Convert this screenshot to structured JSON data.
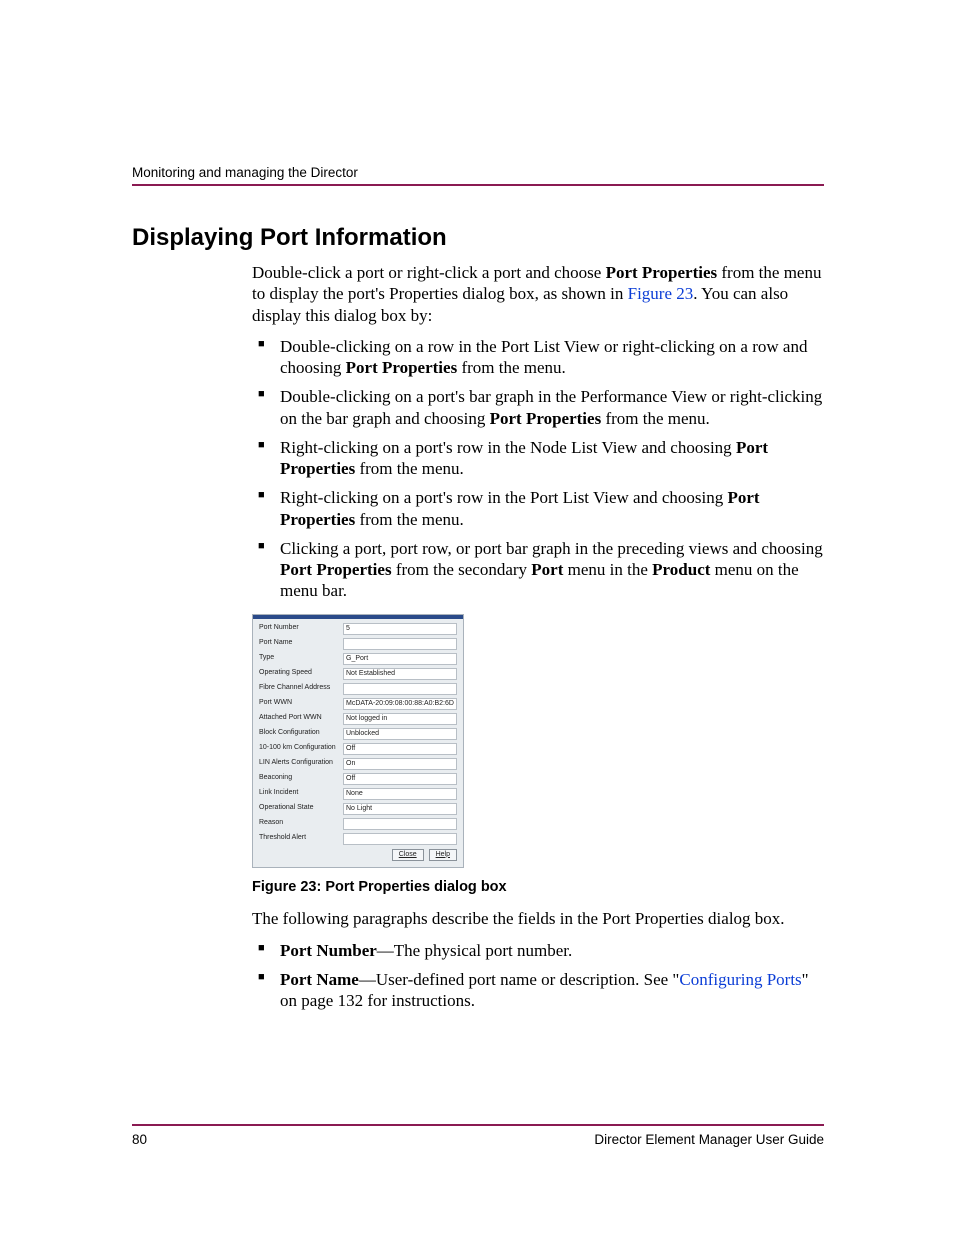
{
  "header": {
    "running": "Monitoring and managing the Director"
  },
  "section": {
    "title": "Displaying Port Information"
  },
  "intro": {
    "p1_a": "Double-click a port or right-click a port and choose ",
    "p1_b": "Port Properties",
    "p1_c": " from the menu to display the port's Properties dialog box, as shown in ",
    "p1_link": "Figure 23",
    "p1_d": ". You can also display this dialog box by:"
  },
  "bullets1": [
    {
      "a": "Double-clicking on a row in the Port List View or right-clicking on a row and choosing ",
      "b": "Port Properties",
      "c": " from the menu."
    },
    {
      "a": "Double-clicking on a port's bar graph in the Performance View or right-clicking on the bar graph and choosing ",
      "b": "Port Properties",
      "c": " from the menu."
    },
    {
      "a": "Right-clicking on a port's row in the Node List View and choosing ",
      "b": "Port Properties",
      "c": " from the menu."
    },
    {
      "a": "Right-clicking on a port's row in the Port List View and choosing ",
      "b": "Port Properties",
      "c": " from the menu."
    },
    {
      "a": "Clicking a port, port row, or port bar graph in the preceding views and choosing ",
      "b": "Port Properties",
      "c": " from the secondary ",
      "d": "Port",
      "e": " menu in the ",
      "f": "Product",
      "g": " menu on the menu bar."
    }
  ],
  "dialog": {
    "rows": [
      {
        "label": "Port Number",
        "value": "5"
      },
      {
        "label": "Port Name",
        "value": ""
      },
      {
        "label": "Type",
        "value": "G_Port"
      },
      {
        "label": "Operating Speed",
        "value": "Not Established"
      },
      {
        "label": "Fibre Channel Address",
        "value": ""
      },
      {
        "label": "Port WWN",
        "value": "McDATA-20:09:08:00:88:A0:B2:6D"
      },
      {
        "label": "Attached Port WWN",
        "value": "Not logged in"
      },
      {
        "label": "Block Configuration",
        "value": "Unblocked"
      },
      {
        "label": "10-100 km Configuration",
        "value": "Off"
      },
      {
        "label": "LIN Alerts Configuration",
        "value": "On"
      },
      {
        "label": "Beaconing",
        "value": "Off"
      },
      {
        "label": "Link Incident",
        "value": "None"
      },
      {
        "label": "Operational State",
        "value": "No Light"
      },
      {
        "label": "Reason",
        "value": ""
      },
      {
        "label": "Threshold Alert",
        "value": ""
      }
    ],
    "close": "Close",
    "help": "Help"
  },
  "figcap": "Figure 23:  Port Properties dialog box",
  "after": "The following paragraphs describe the fields in the Port Properties dialog box.",
  "bullets2": {
    "i1_a": "Port Number",
    "i1_b": "—The physical port number.",
    "i2_a": "Port Name",
    "i2_b": "—User-defined port name or description. See \"",
    "i2_link": "Configuring Ports",
    "i2_c": "\" on page 132 for instructions."
  },
  "footer": {
    "page": "80",
    "doc": "Director Element Manager User Guide"
  }
}
